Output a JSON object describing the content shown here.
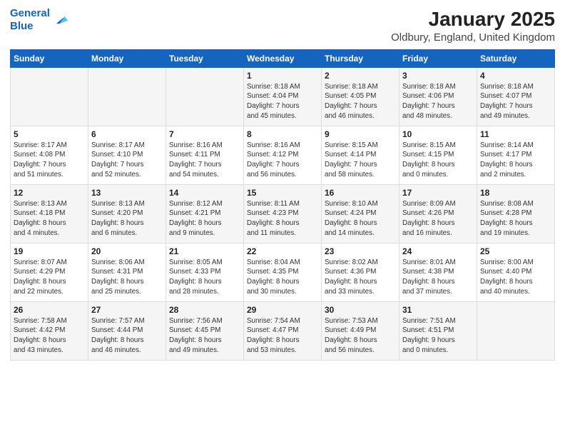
{
  "logo": {
    "line1": "General",
    "line2": "Blue"
  },
  "title": "January 2025",
  "subtitle": "Oldbury, England, United Kingdom",
  "days_header": [
    "Sunday",
    "Monday",
    "Tuesday",
    "Wednesday",
    "Thursday",
    "Friday",
    "Saturday"
  ],
  "weeks": [
    [
      {
        "num": "",
        "info": ""
      },
      {
        "num": "",
        "info": ""
      },
      {
        "num": "",
        "info": ""
      },
      {
        "num": "1",
        "info": "Sunrise: 8:18 AM\nSunset: 4:04 PM\nDaylight: 7 hours\nand 45 minutes."
      },
      {
        "num": "2",
        "info": "Sunrise: 8:18 AM\nSunset: 4:05 PM\nDaylight: 7 hours\nand 46 minutes."
      },
      {
        "num": "3",
        "info": "Sunrise: 8:18 AM\nSunset: 4:06 PM\nDaylight: 7 hours\nand 48 minutes."
      },
      {
        "num": "4",
        "info": "Sunrise: 8:18 AM\nSunset: 4:07 PM\nDaylight: 7 hours\nand 49 minutes."
      }
    ],
    [
      {
        "num": "5",
        "info": "Sunrise: 8:17 AM\nSunset: 4:08 PM\nDaylight: 7 hours\nand 51 minutes."
      },
      {
        "num": "6",
        "info": "Sunrise: 8:17 AM\nSunset: 4:10 PM\nDaylight: 7 hours\nand 52 minutes."
      },
      {
        "num": "7",
        "info": "Sunrise: 8:16 AM\nSunset: 4:11 PM\nDaylight: 7 hours\nand 54 minutes."
      },
      {
        "num": "8",
        "info": "Sunrise: 8:16 AM\nSunset: 4:12 PM\nDaylight: 7 hours\nand 56 minutes."
      },
      {
        "num": "9",
        "info": "Sunrise: 8:15 AM\nSunset: 4:14 PM\nDaylight: 7 hours\nand 58 minutes."
      },
      {
        "num": "10",
        "info": "Sunrise: 8:15 AM\nSunset: 4:15 PM\nDaylight: 8 hours\nand 0 minutes."
      },
      {
        "num": "11",
        "info": "Sunrise: 8:14 AM\nSunset: 4:17 PM\nDaylight: 8 hours\nand 2 minutes."
      }
    ],
    [
      {
        "num": "12",
        "info": "Sunrise: 8:13 AM\nSunset: 4:18 PM\nDaylight: 8 hours\nand 4 minutes."
      },
      {
        "num": "13",
        "info": "Sunrise: 8:13 AM\nSunset: 4:20 PM\nDaylight: 8 hours\nand 6 minutes."
      },
      {
        "num": "14",
        "info": "Sunrise: 8:12 AM\nSunset: 4:21 PM\nDaylight: 8 hours\nand 9 minutes."
      },
      {
        "num": "15",
        "info": "Sunrise: 8:11 AM\nSunset: 4:23 PM\nDaylight: 8 hours\nand 11 minutes."
      },
      {
        "num": "16",
        "info": "Sunrise: 8:10 AM\nSunset: 4:24 PM\nDaylight: 8 hours\nand 14 minutes."
      },
      {
        "num": "17",
        "info": "Sunrise: 8:09 AM\nSunset: 4:26 PM\nDaylight: 8 hours\nand 16 minutes."
      },
      {
        "num": "18",
        "info": "Sunrise: 8:08 AM\nSunset: 4:28 PM\nDaylight: 8 hours\nand 19 minutes."
      }
    ],
    [
      {
        "num": "19",
        "info": "Sunrise: 8:07 AM\nSunset: 4:29 PM\nDaylight: 8 hours\nand 22 minutes."
      },
      {
        "num": "20",
        "info": "Sunrise: 8:06 AM\nSunset: 4:31 PM\nDaylight: 8 hours\nand 25 minutes."
      },
      {
        "num": "21",
        "info": "Sunrise: 8:05 AM\nSunset: 4:33 PM\nDaylight: 8 hours\nand 28 minutes."
      },
      {
        "num": "22",
        "info": "Sunrise: 8:04 AM\nSunset: 4:35 PM\nDaylight: 8 hours\nand 30 minutes."
      },
      {
        "num": "23",
        "info": "Sunrise: 8:02 AM\nSunset: 4:36 PM\nDaylight: 8 hours\nand 33 minutes."
      },
      {
        "num": "24",
        "info": "Sunrise: 8:01 AM\nSunset: 4:38 PM\nDaylight: 8 hours\nand 37 minutes."
      },
      {
        "num": "25",
        "info": "Sunrise: 8:00 AM\nSunset: 4:40 PM\nDaylight: 8 hours\nand 40 minutes."
      }
    ],
    [
      {
        "num": "26",
        "info": "Sunrise: 7:58 AM\nSunset: 4:42 PM\nDaylight: 8 hours\nand 43 minutes."
      },
      {
        "num": "27",
        "info": "Sunrise: 7:57 AM\nSunset: 4:44 PM\nDaylight: 8 hours\nand 46 minutes."
      },
      {
        "num": "28",
        "info": "Sunrise: 7:56 AM\nSunset: 4:45 PM\nDaylight: 8 hours\nand 49 minutes."
      },
      {
        "num": "29",
        "info": "Sunrise: 7:54 AM\nSunset: 4:47 PM\nDaylight: 8 hours\nand 53 minutes."
      },
      {
        "num": "30",
        "info": "Sunrise: 7:53 AM\nSunset: 4:49 PM\nDaylight: 8 hours\nand 56 minutes."
      },
      {
        "num": "31",
        "info": "Sunrise: 7:51 AM\nSunset: 4:51 PM\nDaylight: 9 hours\nand 0 minutes."
      },
      {
        "num": "",
        "info": ""
      }
    ]
  ],
  "colors": {
    "header_bg": "#1565c0",
    "odd_row": "#f5f5f5",
    "even_row": "#ffffff"
  }
}
